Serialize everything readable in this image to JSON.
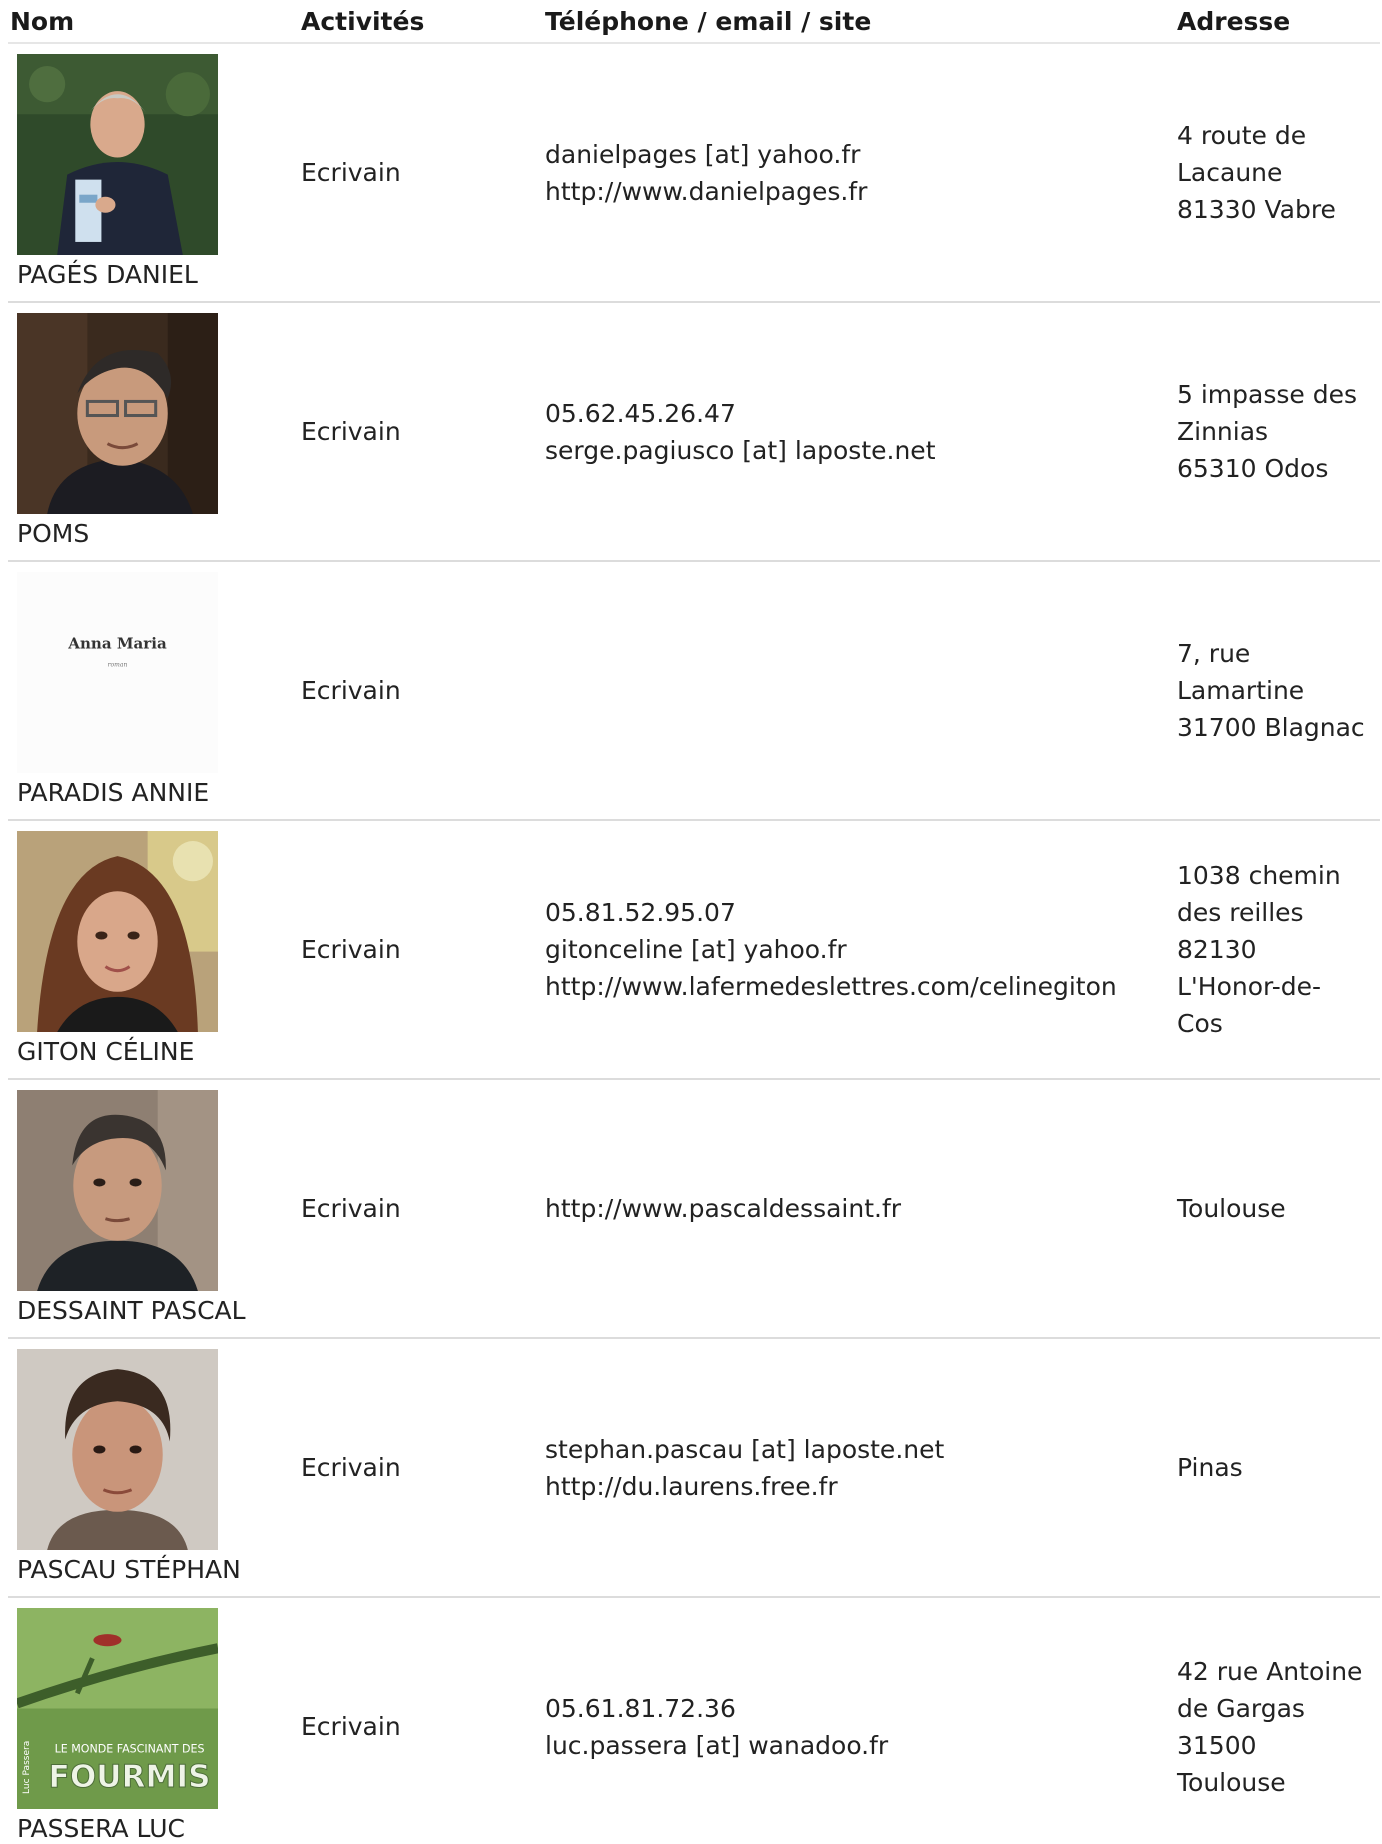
{
  "headers": {
    "nom": "Nom",
    "activites": "Activités",
    "contact": "Téléphone / email / site",
    "adresse": "Adresse"
  },
  "rows": [
    {
      "name": "PAGÉS DANIEL",
      "activity": "Ecrivain",
      "contact": [
        "danielpages [at] yahoo.fr",
        "http://www.danielpages.fr"
      ],
      "address": [
        "4 route de",
        "Lacaune",
        "81330 Vabre"
      ]
    },
    {
      "name": "POMS",
      "activity": "Ecrivain",
      "contact": [
        "05.62.45.26.47",
        "serge.pagiusco [at] laposte.net"
      ],
      "address": [
        "5 impasse des",
        "Zinnias",
        "65310 Odos"
      ]
    },
    {
      "name": "PARADIS ANNIE",
      "activity": "Ecrivain",
      "contact": [],
      "address": [
        "7, rue",
        "Lamartine",
        "31700 Blagnac"
      ],
      "cover_title": "Anna Maria",
      "cover_subtitle": "roman"
    },
    {
      "name": "GITON CÉLINE",
      "activity": "Ecrivain",
      "contact": [
        "05.81.52.95.07",
        "gitonceline [at] yahoo.fr",
        "http://www.lafermedeslettres.com/celinegiton"
      ],
      "address": [
        "1038 chemin",
        "des reilles",
        "82130",
        "L'Honor-de-",
        "Cos"
      ]
    },
    {
      "name": "DESSAINT PASCAL",
      "activity": "Ecrivain",
      "contact": [
        "http://www.pascaldessaint.fr"
      ],
      "address": [
        "Toulouse"
      ]
    },
    {
      "name": "PASCAU STÉPHAN",
      "activity": "Ecrivain",
      "contact": [
        "stephan.pascau [at] laposte.net",
        "http://du.laurens.free.fr"
      ],
      "address": [
        "Pinas"
      ]
    },
    {
      "name": "PASSERA LUC",
      "activity": "Ecrivain",
      "contact": [
        "05.61.81.72.36",
        "luc.passera [at] wanadoo.fr"
      ],
      "address": [
        "42 rue Antoine",
        "de Gargas",
        "31500",
        "Toulouse"
      ],
      "cover_series": "LE MONDE FASCINANT DES",
      "cover_title": "FOURMIS",
      "cover_author": "Luc Passera"
    }
  ],
  "colors": {
    "header_border": "#e6e6e6",
    "row_border": "#dcdcdc",
    "text": "#222222"
  }
}
